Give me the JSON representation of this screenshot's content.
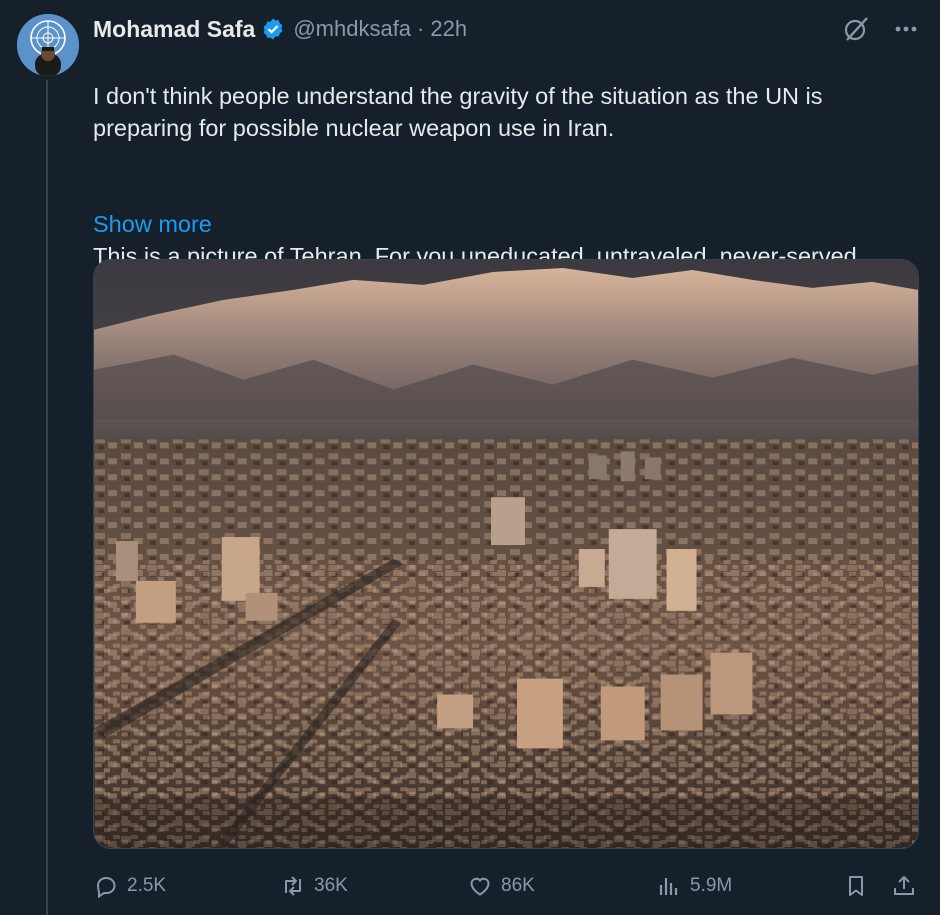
{
  "tweet": {
    "author_name": "Mohamad Safa",
    "handle": "@mhdksafa",
    "separator": "·",
    "time": "22h",
    "text_p1": "I don't think people understand the gravity of the situation as the UN is preparing for possible nuclear weapon use in Iran.",
    "text_p2": "This is a picture of Tehran. For you uneducated, untraveled, never-served, warhawks licking your chops at the thought of bombing it. It's not some low",
    "show_more": "Show more",
    "icons": {
      "verified": "verified-badge-icon",
      "grok": "grok-icon",
      "more": "more-icon"
    }
  },
  "actions": {
    "replies": "2.5K",
    "reposts": "36K",
    "likes": "86K",
    "views": "5.9M"
  },
  "colors": {
    "background": "#15202b",
    "text": "#e7e9ea",
    "muted": "#8b98a5",
    "accent": "#1d9bf0"
  }
}
